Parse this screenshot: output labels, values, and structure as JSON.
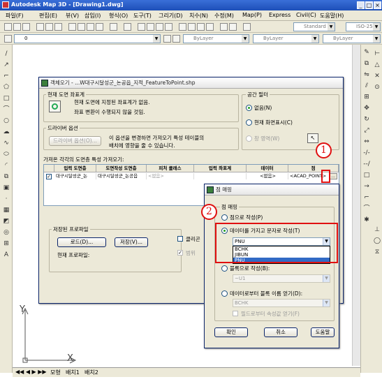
{
  "window": {
    "title": "Autodesk Map 3D - [Drawing1.dwg]",
    "icon": "autocad-app-icon"
  },
  "menu": [
    "파일(F)",
    "편집(E)",
    "뷰(V)",
    "삽입(I)",
    "형식(O)",
    "도구(T)",
    "그리기(D)",
    "치수(N)",
    "수정(M)",
    "Map(P)",
    "Express",
    "Civil(C)",
    "도움말(H)"
  ],
  "toolbar2": {
    "style_combo": "Standard",
    "dim_combo": "ISO-25"
  },
  "toolbar3": {
    "layer_combo": "0",
    "color_combo": "ByLayer",
    "linetype_combo": "ByLayer",
    "lineweight_combo": "ByLayer"
  },
  "layout_tabs": [
    "모형",
    "배치1",
    "배치2"
  ],
  "ucs": {
    "x": "X",
    "y": "Y"
  },
  "import_dialog": {
    "title": "객체오기 - ...W대구시달성군_논공읍_지적_FeatureToPoint.shp",
    "coord_group": "현재 도면 좌표계",
    "coord_msg1": "현재 도면에 지정된 좌표계가 없음.",
    "coord_msg2": "좌표 변환이 수행되지 않을 것임.",
    "driver_group": "드라이버 옵션",
    "driver_button": "드라이버 옵션(O)...",
    "driver_msg1": "이 옵션을 변경하면 가져오기 특성 테이블의",
    "driver_msg2": "배치에 영향을 줄 수 있습니다.",
    "spatial_group": "공간 필터",
    "radio_none": "없음(N)",
    "radio_current": "현재 화면표시(C)",
    "radio_window": "창 영역(W)",
    "table_label": "가져온 각각의 도면층 특성 가져오기:",
    "columns": [
      "입력 도면층",
      "도면작성 도면층",
      "피처 클래스",
      "입력 좌표계",
      "데이터",
      "점"
    ],
    "row": [
      "대구시달성군_논",
      "대구시달성군_논공읍",
      "<없음>",
      "",
      "<없음>",
      "<ACAD_POINT>"
    ],
    "profile_group": "저장된 프로파일",
    "load_button": "로드(D)...",
    "save_button": "저장(V)...",
    "current_profile": "현재 프로파일:",
    "clean_check": "클리곤",
    "polygon_check": "범위"
  },
  "point_dialog": {
    "title": "점 매핑",
    "group": "점 매핑",
    "opt_point": "점으로 작성(P)",
    "opt_text": "데이터를 가지고 문자로 작성(T)",
    "text_combo": "PNU",
    "dropdown_items": [
      "BCHK",
      "JIBUN",
      "PNU"
    ],
    "opt_block": "블록으로 작성(B):",
    "block_combo": "~U1",
    "opt_block_from_data": "데이터로부터 블록 이름 얻기(D):",
    "block_data_combo": "BCHK",
    "attr_check": "필드로부터 속성값 얻기(F)",
    "ok": "확인",
    "cancel": "취소",
    "help": "도움말"
  },
  "callouts": [
    "1",
    "2"
  ]
}
